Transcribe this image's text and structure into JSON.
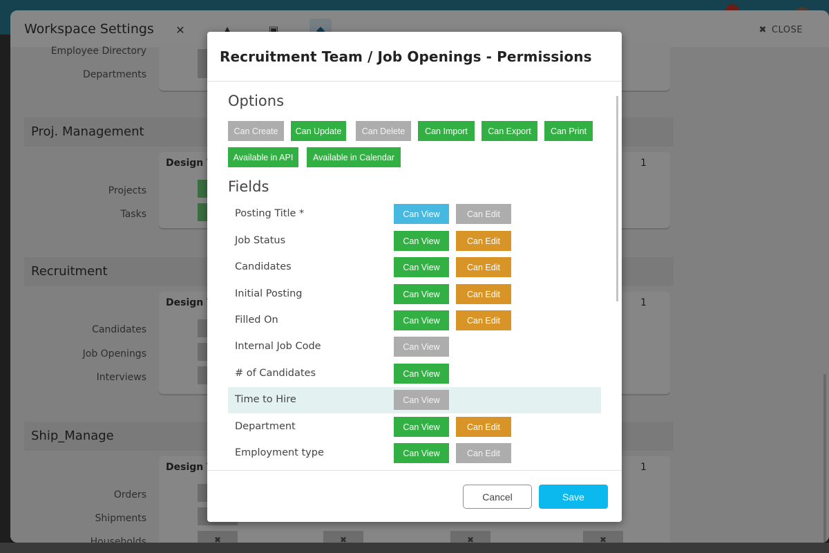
{
  "app": {
    "workspace_title": "Workspace Settings",
    "close_label": "CLOSE",
    "tabs": [
      {
        "icon": "tools-icon",
        "glyph": "✕"
      },
      {
        "icon": "shapes-icon",
        "glyph": "▲"
      },
      {
        "icon": "form-icon",
        "glyph": "▣"
      },
      {
        "icon": "shield-icon",
        "glyph": "◆"
      }
    ]
  },
  "background": {
    "top_rows": [
      "Employee Directory",
      "Departments"
    ],
    "sections": [
      {
        "title": "Proj. Management",
        "team": "Design Team",
        "team_count": "1",
        "rows": [
          "Projects",
          "Tasks"
        ]
      },
      {
        "title": "Recruitment",
        "team": "Design Team",
        "team_count": "1",
        "rows": [
          "Candidates",
          "Job Openings",
          "Interviews"
        ]
      },
      {
        "title": "Ship_Manage",
        "team": "Design Team",
        "team_count": "1",
        "rows": [
          "Orders",
          "Shipments",
          "Households"
        ]
      }
    ],
    "denied_mark": "✖"
  },
  "modal": {
    "title": "Recruitment Team / Job Openings - Permissions",
    "options_heading": "Options",
    "options": [
      {
        "label": "Can Create",
        "state": "off"
      },
      {
        "label": "Can Update",
        "state": "on"
      },
      {
        "label": "Can Delete",
        "state": "off"
      },
      {
        "label": "Can Import",
        "state": "on"
      },
      {
        "label": "Can Export",
        "state": "on"
      },
      {
        "label": "Can Print",
        "state": "on"
      },
      {
        "label": "Available in API",
        "state": "on"
      },
      {
        "label": "Available in Calendar",
        "state": "on"
      }
    ],
    "fields_heading": "Fields",
    "view_label": "Can View",
    "edit_label": "Can Edit",
    "fields": [
      {
        "name": "Posting Title *",
        "view": "required",
        "edit": "off"
      },
      {
        "name": "Job Status",
        "view": "on",
        "edit": "on"
      },
      {
        "name": "Candidates",
        "view": "on",
        "edit": "on"
      },
      {
        "name": "Initial Posting",
        "view": "on",
        "edit": "on"
      },
      {
        "name": "Filled On",
        "view": "on",
        "edit": "on"
      },
      {
        "name": "Internal Job Code",
        "view": "off",
        "edit": null
      },
      {
        "name": "# of Candidates",
        "view": "on",
        "edit": null
      },
      {
        "name": "Time to Hire",
        "view": "off",
        "edit": null,
        "highlighted": true
      },
      {
        "name": "Department",
        "view": "on",
        "edit": "on"
      },
      {
        "name": "Employment type",
        "view": "on",
        "edit": "off"
      }
    ],
    "cancel_label": "Cancel",
    "save_label": "Save"
  },
  "colors": {
    "on": "#33b043",
    "off": "#adadad",
    "required": "#47b8e0",
    "edit_on": "#d99428",
    "save": "#0cb9ef"
  }
}
